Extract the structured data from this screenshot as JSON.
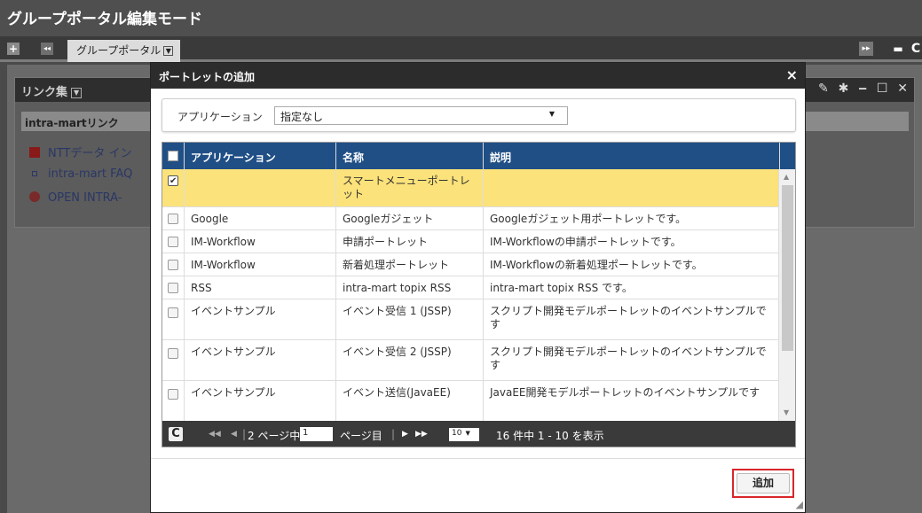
{
  "app": {
    "title": "グループポータル編集モード"
  },
  "tabbar": {
    "tab_label": "グループポータル",
    "add_icon": "+",
    "collapse_icon": "◂◂",
    "right_icons": [
      "▸▸",
      "▬",
      "C"
    ]
  },
  "portlet": {
    "title": "リンク集",
    "subheader": "intra-martリンク",
    "tools": "✎ ✱ ‒ ☐ ✕",
    "links": [
      {
        "label": "NTTデータ イン",
        "icon": "ntt-logo-icon"
      },
      {
        "label": "intra-mart FAQ",
        "icon": "faq-icon"
      },
      {
        "label": "OPEN INTRA-",
        "icon": "open-intra-icon"
      }
    ]
  },
  "dialog": {
    "title": "ポートレットの追加",
    "close": "×",
    "filter_label": "アプリケーション",
    "filter_value": "指定なし",
    "columns": [
      "アプリケーション",
      "名称",
      "説明"
    ],
    "rows": [
      {
        "checked": true,
        "app": "",
        "name": "スマートメニューポートレット",
        "desc": ""
      },
      {
        "checked": false,
        "app": "Google",
        "name": "Googleガジェット",
        "desc": "Googleガジェット用ポートレットです。"
      },
      {
        "checked": false,
        "app": "IM-Workflow",
        "name": "申請ポートレット",
        "desc": "IM-Workflowの申請ポートレットです。"
      },
      {
        "checked": false,
        "app": "IM-Workflow",
        "name": "新着処理ポートレット",
        "desc": "IM-Workflowの新着処理ポートレットです。"
      },
      {
        "checked": false,
        "app": "RSS",
        "name": "intra-mart topix RSS",
        "desc": "intra-mart topix RSS です。"
      },
      {
        "checked": false,
        "app": "イベントサンプル",
        "name": "イベント受信 1 (JSSP)",
        "desc": "スクリプト開発モデルポートレットのイベントサンプルです"
      },
      {
        "checked": false,
        "app": "イベントサンプル",
        "name": "イベント受信 2 (JSSP)",
        "desc": "スクリプト開発モデルポートレットのイベントサンプルです"
      },
      {
        "checked": false,
        "app": "イベントサンプル",
        "name": "イベント送信(JavaEE)",
        "desc": "JavaEE開発モデルポートレットのイベントサンプルです"
      }
    ],
    "pager": {
      "page_of": "2 ページ中",
      "page_input": "1",
      "page_suffix": "ページ目",
      "page_size": "10",
      "summary": "16 件中 1 - 10 を表示"
    },
    "add_button": "追加"
  }
}
